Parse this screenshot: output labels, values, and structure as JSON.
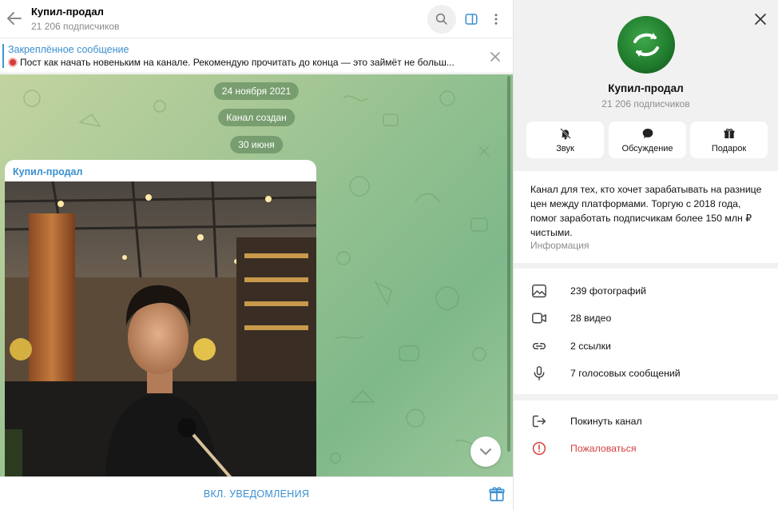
{
  "header": {
    "title": "Купил-продал",
    "subtitle": "21 206 подписчиков"
  },
  "pinned": {
    "title": "Закреплённое сообщение",
    "text": "Пост как начать новеньким на канале. Рекомендую прочитать до конца — это займёт не больш..."
  },
  "chat": {
    "pills": [
      "24 ноября 2021",
      "Канал создан",
      "30 июня"
    ],
    "message_author": "Купил-продал"
  },
  "footer": {
    "notify_label": "ВКЛ. УВЕДОМЛЕНИЯ"
  },
  "info": {
    "title": "Купил-продал",
    "subtitle": "21 206 подписчиков",
    "actions": [
      {
        "label": "Звук",
        "icon": "bell-muted-icon"
      },
      {
        "label": "Обсуждение",
        "icon": "chat-bubble-icon"
      },
      {
        "label": "Подарок",
        "icon": "gift-icon"
      }
    ],
    "description": "Канал для тех, кто хочет зарабатывать на разнице цен между платформами. Торгую с 2018 года, помог заработать подписчикам более 150 млн ₽ чистыми.",
    "description_label": "Информация",
    "media": [
      {
        "label": "239 фотографий",
        "icon": "photo-icon"
      },
      {
        "label": "28 видео",
        "icon": "video-icon"
      },
      {
        "label": "2 ссылки",
        "icon": "link-icon"
      },
      {
        "label": "7 голосовых сообщений",
        "icon": "microphone-icon"
      }
    ],
    "leave_label": "Покинуть канал",
    "report_label": "Пожаловаться"
  },
  "colors": {
    "accent": "#3a8fd0",
    "danger": "#d64040",
    "wallpaper_green": "#8fbf8f"
  }
}
